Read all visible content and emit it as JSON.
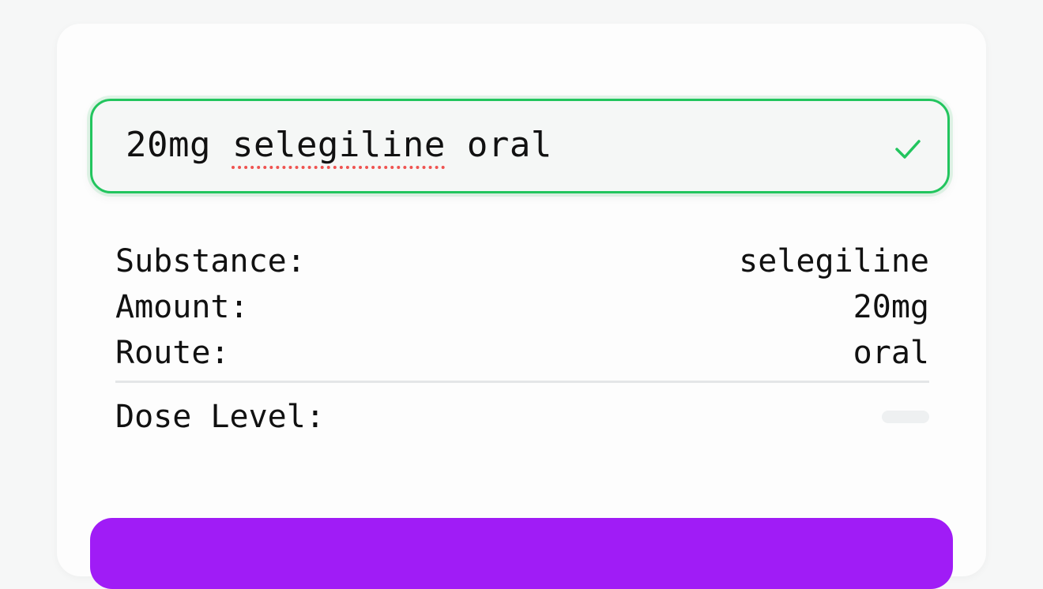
{
  "dose_input": {
    "amount": "20mg",
    "substance": "selegiline",
    "route": "oral",
    "valid_icon": "check-icon",
    "border_color": "#22c55e"
  },
  "parsed": {
    "substance_label": "Substance:",
    "substance_value": "selegiline",
    "amount_label": "Amount:",
    "amount_value": "20mg",
    "route_label": "Route:",
    "route_value": "oral",
    "dose_level_label": "Dose Level:"
  },
  "submit_button": {
    "color": "#a01cf6"
  }
}
